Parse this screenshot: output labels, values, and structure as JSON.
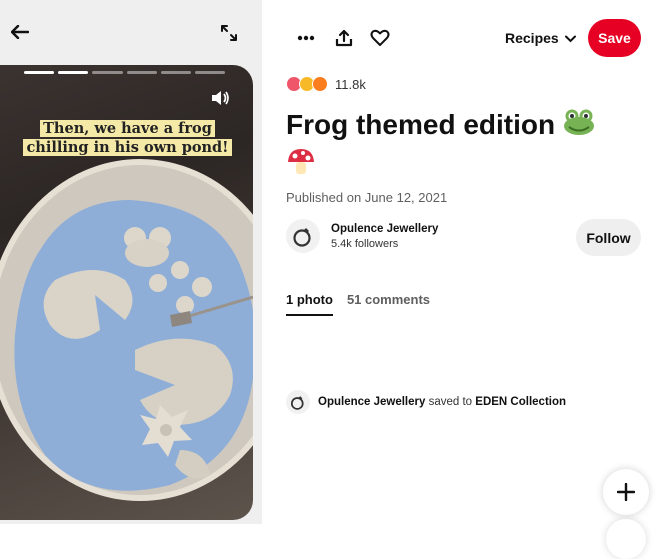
{
  "media": {
    "caption": "Then, we have a frog chilling in his own pond!",
    "story_progress": {
      "total_segments": 6,
      "completed_segments": 2
    }
  },
  "icons": {
    "back": "arrow-left-icon",
    "expand": "expand-icon",
    "volume": "volume-icon",
    "more": "more-icon",
    "share": "share-icon",
    "heart": "heart-icon",
    "chevron": "chevron-down-icon",
    "add": "plus-icon"
  },
  "toolbar": {
    "board_label": "Recipes",
    "save_label": "Save"
  },
  "pin": {
    "reactions_count": "11.8k",
    "title": "Frog themed edition",
    "title_emojis": [
      "frog-emoji",
      "mushroom-emoji"
    ],
    "published": "Published on June 12, 2021"
  },
  "creator": {
    "name": "Opulence Jewellery",
    "followers": "5.4k followers",
    "follow_label": "Follow"
  },
  "tabs": [
    {
      "label": "1 photo",
      "active": true
    },
    {
      "label": "51 comments",
      "active": false
    }
  ],
  "activity": {
    "user": "Opulence Jewellery",
    "action": "saved to",
    "board": "EDEN Collection"
  },
  "colors": {
    "save_button": "#e60023",
    "follow_button": "#efefef",
    "caption_highlight": "#f5e9a8"
  }
}
